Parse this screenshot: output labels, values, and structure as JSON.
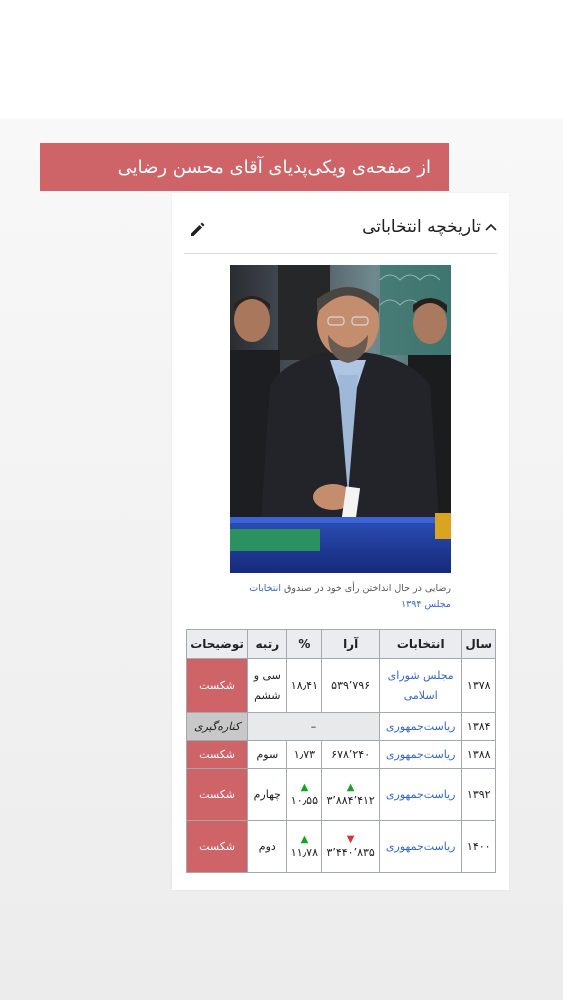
{
  "banner": {
    "text": "از صفحه‌ی ویکی‌پدیای آقای محسن رضایی"
  },
  "section": {
    "title": "تاریخچه انتخاباتی",
    "toggle_icon": "chevron-up-icon",
    "edit_icon": "pencil-icon"
  },
  "photo": {
    "caption_part1": "رضایی در حال انداختن رأی خود در صندوق",
    "caption_link": "انتخابات مجلس ۱۳۹۴"
  },
  "table": {
    "headers": [
      "سال",
      "انتخابات",
      "آرا",
      "%",
      "رتبه",
      "توضیحات"
    ],
    "rows": [
      {
        "year": "۱۳۷۸",
        "election": "مجلس شورای اسلامی",
        "votes": "۵۳۹٬۷۹۶",
        "percent": "۱۸٫۴۱",
        "rank": "سی و ششم",
        "note": "شکست"
      },
      {
        "year": "۱۳۸۴",
        "election": "ریاست‌جمهوری",
        "merged": "–",
        "note": "کناره‌گیری"
      },
      {
        "year": "۱۳۸۸",
        "election": "ریاست‌جمهوری",
        "votes": "۶۷۸٬۲۴۰",
        "percent": "۱٫۷۳",
        "rank": "سوم",
        "note": "شکست"
      },
      {
        "year": "۱۳۹۲",
        "election": "ریاست‌جمهوری",
        "votes": "۳٬۸۸۴٬۴۱۲",
        "votes_trend": "up",
        "percent": "۱۰٫۵۵",
        "percent_trend": "up",
        "rank": "چهارم",
        "note": "شکست"
      },
      {
        "year": "۱۴۰۰",
        "election": "ریاست‌جمهوری",
        "votes": "۳٬۴۴۰٬۸۳۵",
        "votes_trend": "down",
        "percent": "۱۱٫۷۸",
        "percent_trend": "up",
        "rank": "دوم",
        "note": "شکست"
      }
    ]
  },
  "colors": {
    "loss": "#cf6468",
    "link": "#3366cc",
    "up": "#14a325",
    "down": "#dd3333"
  }
}
